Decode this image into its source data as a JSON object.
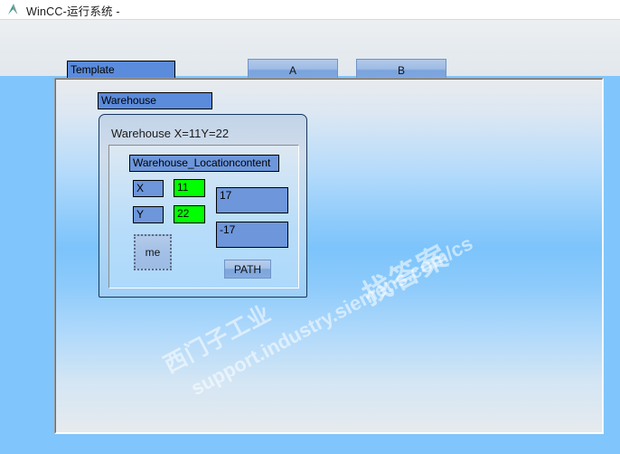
{
  "window": {
    "title": "WinCC-运行系统 -",
    "icon": "wincc-triangle-icon"
  },
  "toolbar": {
    "template_field_value": "Template",
    "button_a_label": "A",
    "button_b_label": "B"
  },
  "screen": {
    "warehouse_label": "Warehouse",
    "panel": {
      "title": "Warehouse X=11Y=22",
      "location_content_label": "Warehouse_Locationcontent",
      "x_label": "X",
      "x_value": "11",
      "y_label": "Y",
      "y_value": "22",
      "value_1": "17",
      "value_2": "-17",
      "me_button_label": "me",
      "path_button_label": "PATH"
    }
  },
  "watermark": {
    "line1": "西门子工业",
    "line2": "support.industry.siemens.com/cs",
    "line3": "找答案"
  },
  "colors": {
    "field_blue": "#6d96db",
    "value_green": "#00ff00",
    "accent_blue": "#5b8bdb",
    "background_blue": "#7cc4fb"
  }
}
